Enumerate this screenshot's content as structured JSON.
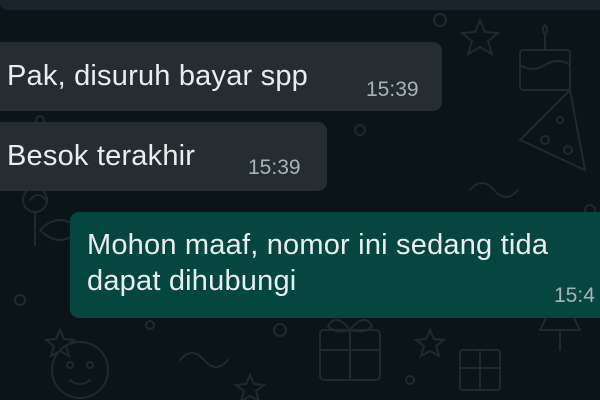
{
  "theme": {
    "background": "#0b1519",
    "incoming_bubble": "#262d31",
    "outgoing_bubble": "#054740",
    "text": "#e9edef",
    "timestamp": "#a6b3b9"
  },
  "messages": [
    {
      "direction": "incoming",
      "text": "Pak, disuruh bayar spp",
      "time": "15:39"
    },
    {
      "direction": "incoming",
      "text": "Besok terakhir",
      "time": "15:39"
    },
    {
      "direction": "outgoing",
      "text": "Mohon maaf, nomor ini sedang tida\ndapat dihubungi",
      "time": "15:4"
    }
  ]
}
